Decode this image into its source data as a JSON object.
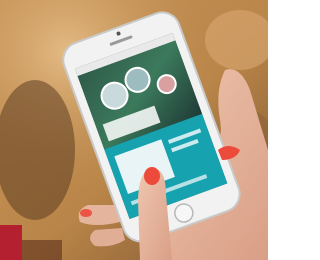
{
  "photo": {
    "subject": "hand-holding-smartphone",
    "colors": {
      "background_warm": "#b98548",
      "background_dark": "#6e4a2a",
      "phone_body": "#f2f2f2",
      "screen_teal": "#17a2b0",
      "screen_dark": "#244247",
      "skin": "#e8b9a4",
      "nail_polish": "#ec4a3a",
      "red_object": "#b42030"
    },
    "icons": [
      "phone-icon",
      "home-button-icon",
      "camera-lens-icon",
      "speaker-slot-icon"
    ]
  }
}
